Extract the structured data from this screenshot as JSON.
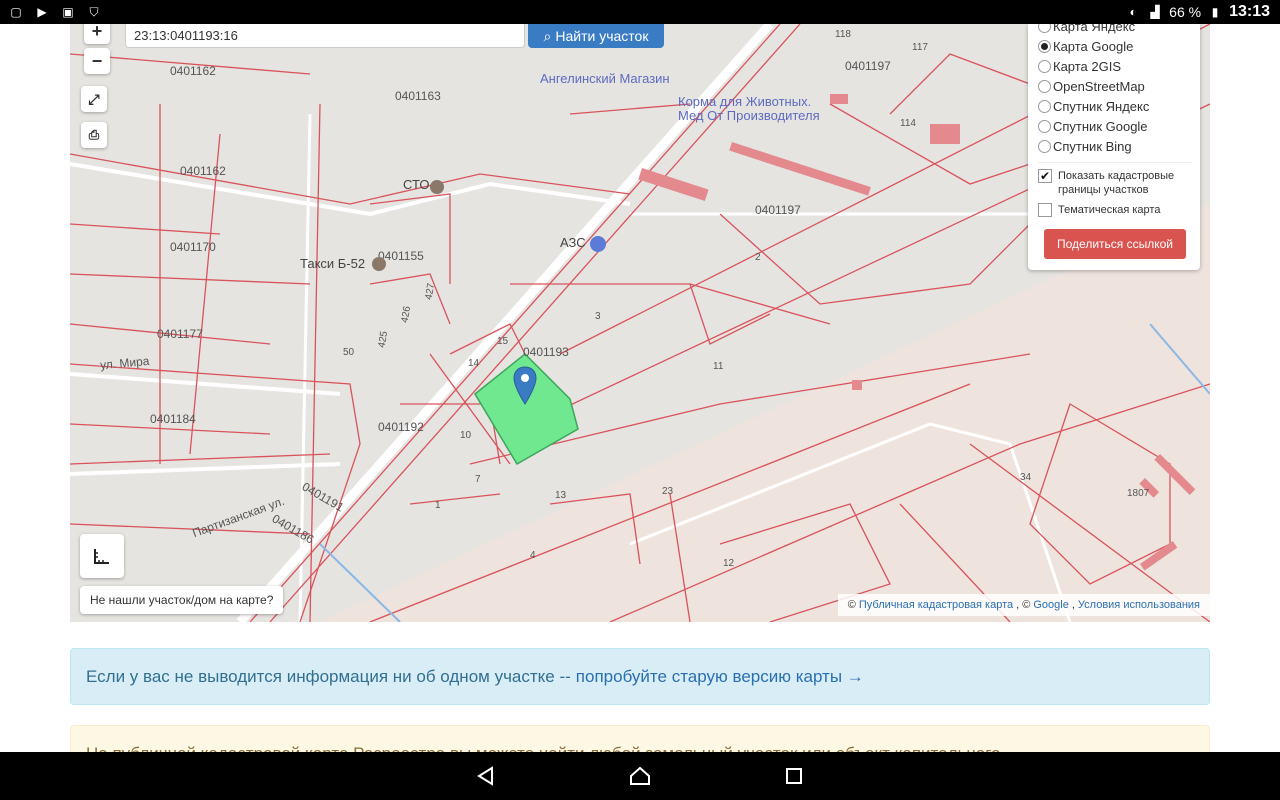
{
  "status_bar": {
    "battery": "66 %",
    "time": "13:13"
  },
  "search": {
    "value": "23:13:0401193:16",
    "button_label": "Найти участок"
  },
  "zoom": {
    "plus": "+",
    "minus": "−"
  },
  "layers": {
    "options": [
      {
        "label": "Карта Яндекс",
        "selected": false
      },
      {
        "label": "Карта Google",
        "selected": true
      },
      {
        "label": "Карта 2GIS",
        "selected": false
      },
      {
        "label": "OpenStreetMap",
        "selected": false
      },
      {
        "label": "Спутник Яндекс",
        "selected": false
      },
      {
        "label": "Спутник Google",
        "selected": false
      },
      {
        "label": "Спутник Bing",
        "selected": false
      }
    ],
    "show_borders": {
      "label": "Показать кадастровые границы участков",
      "checked": true
    },
    "thematic": {
      "label": "Тематическая карта",
      "checked": false
    },
    "share_label": "Поделиться ссылкой"
  },
  "map": {
    "selected_parcel_color": "#6fe88f",
    "cadastral_line_color": "#d9535a",
    "labels": {
      "q0401193": "0401193",
      "q0401197a": "0401197",
      "q0401197b": "0401197",
      "q0401163": "0401163",
      "q0401162a": "0401162",
      "q0401162b": "0401162",
      "q0401170": "0401170",
      "q0401155": "0401155",
      "q0401177": "0401177",
      "q0401184a": "0401184",
      "q0401184b": "0401184",
      "q0401192": "0401192",
      "q0401191": "0401191",
      "q0401186": "0401186",
      "n3": "3",
      "n2": "2",
      "n11": "11",
      "n14": "14",
      "n15": "15",
      "n10": "10",
      "n7": "7",
      "n1": "1",
      "n13": "13",
      "n23": "23",
      "n12": "12",
      "n4": "4",
      "n34": "34",
      "n1807": "1807",
      "n114": "114",
      "n118": "118",
      "n117": "117",
      "n50": "50",
      "n425": "425",
      "n426": "426",
      "n427": "427"
    },
    "pois": {
      "sto": "СТО",
      "azs": "АЗС",
      "taxi": "Такси Б-52",
      "shop": "Ангелинский Магазин",
      "pet": "Корма для Животных.",
      "pet2": "Мед От Производителя",
      "street_mira": "ул. Мира",
      "street_partizan": "Партизанская ул."
    }
  },
  "not_found_label": "Не нашли участок/дом на карте?",
  "attribution": {
    "prefix": "©",
    "pkk": "Публичная кадастровая карта",
    "mid": ", ©",
    "google": "Google",
    "sep": ",",
    "terms": "Условия использования"
  },
  "alert_info": {
    "text": "Если у вас не выводится информация ни об одном участке --",
    "link": "попробуйте старую версию карты →"
  },
  "alert_warn": {
    "text": "На публичной кадастровой карте Росреестра вы можете найти любой земельный участок или объект капитального"
  }
}
